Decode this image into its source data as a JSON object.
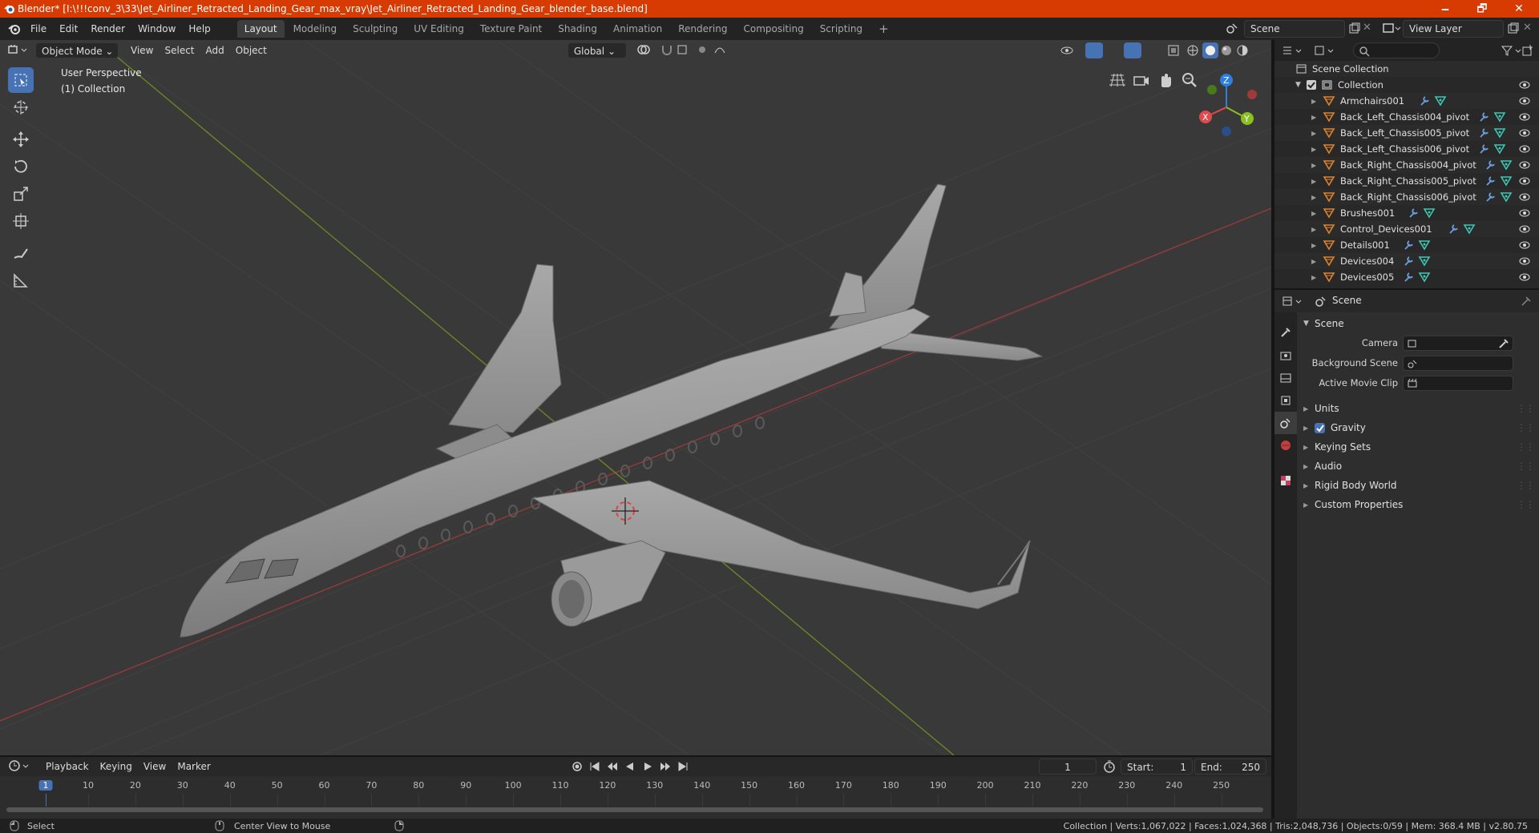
{
  "window": {
    "title": "Blender* [I:\\!!!conv_3\\33\\Jet_Airliner_Retracted_Landing_Gear_max_vray\\Jet_Airliner_Retracted_Landing_Gear_blender_base.blend]",
    "minimize": "🗕",
    "maximize": "🗗",
    "close": "✕"
  },
  "menubar": {
    "menus": [
      "File",
      "Edit",
      "Render",
      "Window",
      "Help"
    ],
    "workspaces": [
      "Layout",
      "Modeling",
      "Sculpting",
      "UV Editing",
      "Texture Paint",
      "Shading",
      "Animation",
      "Rendering",
      "Compositing",
      "Scripting"
    ],
    "add_tab": "+",
    "scene_name": "Scene",
    "view_layer": "View Layer"
  },
  "viewport": {
    "mode": "Object Mode",
    "menus": [
      "View",
      "Select",
      "Add",
      "Object"
    ],
    "orientation": "Global",
    "view_name": "User Perspective",
    "collection_info": "(1) Collection",
    "gizmo": {
      "x": "X",
      "y": "Y",
      "z": "Z"
    }
  },
  "outliner": {
    "root": "Scene Collection",
    "collection": "Collection",
    "items": [
      "Armchairs001",
      "Back_Left_Chassis004_pivot",
      "Back_Left_Chassis005_pivot",
      "Back_Left_Chassis006_pivot",
      "Back_Right_Chassis004_pivot",
      "Back_Right_Chassis005_pivot",
      "Back_Right_Chassis006_pivot",
      "Brushes001",
      "Control_Devices001",
      "Details001",
      "Devices004",
      "Devices005"
    ]
  },
  "properties": {
    "context": "Scene",
    "panel": "Scene",
    "camera_label": "Camera",
    "bg_scene_label": "Background Scene",
    "movie_clip_label": "Active Movie Clip",
    "groups": [
      "Units",
      "Gravity",
      "Keying Sets",
      "Audio",
      "Rigid Body World",
      "Custom Properties"
    ],
    "gravity_checked": true
  },
  "timeline": {
    "menus": [
      "Playback",
      "Keying",
      "View",
      "Marker"
    ],
    "current_frame": "1",
    "start_label": "Start:",
    "start": "1",
    "end_label": "End:",
    "end": "250",
    "ticks": [
      "1",
      "10",
      "20",
      "30",
      "40",
      "50",
      "60",
      "70",
      "80",
      "90",
      "100",
      "110",
      "120",
      "130",
      "140",
      "150",
      "160",
      "170",
      "180",
      "190",
      "200",
      "210",
      "220",
      "230",
      "240",
      "250"
    ]
  },
  "statusbar": {
    "select": "Select",
    "center_view": "Center View to Mouse",
    "stats": "Collection | Verts:1,067,022 | Faces:1,024,368 | Tris:2,048,736 | Objects:0/59 | Mem: 368.4 MB | v2.80.75"
  },
  "colors": {
    "accent": "#d83b01",
    "active_blue": "#4772b3",
    "obj_orange": "#e2842b",
    "mesh_cyan": "#40c8b4",
    "mod_blue": "#6a9fe0"
  }
}
